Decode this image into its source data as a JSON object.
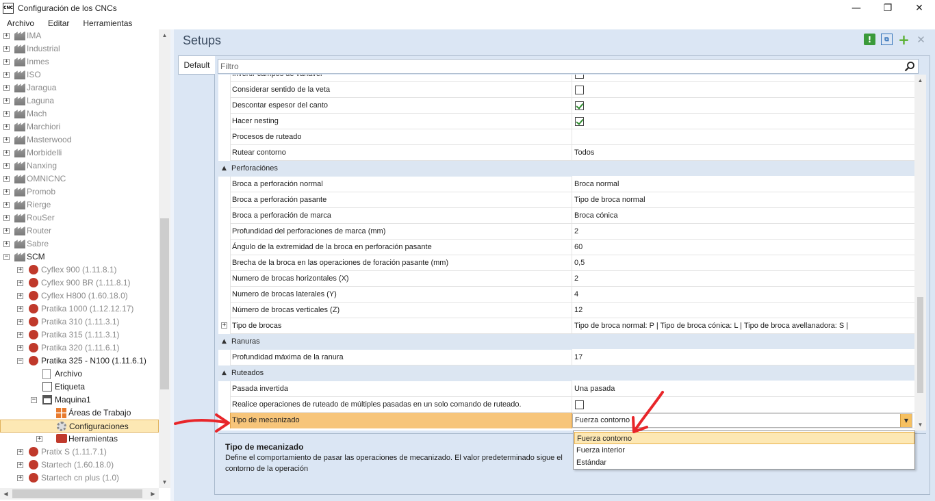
{
  "window": {
    "title": "Configuración de los CNCs",
    "icon_text": "CNC",
    "controls": {
      "minimize": "—",
      "maximize": "❐",
      "close": "✕"
    }
  },
  "menu": [
    "Archivo",
    "Editar",
    "Herramientas"
  ],
  "tree": {
    "manufacturers": [
      "IMA",
      "Industrial",
      "Inmes",
      "ISO",
      "Jaragua",
      "Laguna",
      "Mach",
      "Marchiori",
      "Masterwood",
      "Morbidelli",
      "Nanxing",
      "OMNICNC",
      "Promob",
      "Rierge",
      "RouSer",
      "Router",
      "Sabre"
    ],
    "expanded": "SCM",
    "scm_machines": [
      "Cyflex 900 (1.11.8.1)",
      "Cyflex 900 BR (1.11.8.1)",
      "Cyflex H800 (1.60.18.0)",
      "Pratika 1000 (1.12.12.17)",
      "Pratika 310 (1.11.3.1)",
      "Pratika 315 (1.11.3.1)",
      "Pratika 320 (1.11.6.1)"
    ],
    "open_machine": "Pratika 325 - N100 (1.11.6.1)",
    "open_children": [
      "Archivo",
      "Etiqueta"
    ],
    "maquina": "Maquina1",
    "maquina_children": [
      "Áreas de Trabajo",
      "Configuraciones"
    ],
    "herramientas": "Herramientas",
    "after": [
      "Pratix S (1.11.7.1)",
      "Startech (1.60.18.0)",
      "Startech cn plus (1.0)"
    ]
  },
  "panel": {
    "title": "Setups",
    "tab": "Default",
    "filter_placeholder": "Filtro"
  },
  "grid": {
    "rows": [
      {
        "type": "prop",
        "name": "Invertir campos de variavel",
        "checkbox": false
      },
      {
        "type": "prop",
        "name": "Considerar sentido de la veta",
        "checkbox": false
      },
      {
        "type": "prop",
        "name": "Descontar espesor del canto",
        "checkbox": true
      },
      {
        "type": "prop",
        "name": "Hacer nesting",
        "checkbox": true
      },
      {
        "type": "prop",
        "name": "Procesos de ruteado",
        "value": ""
      },
      {
        "type": "prop",
        "name": "Rutear contorno",
        "value": "Todos"
      },
      {
        "type": "category",
        "name": "Perforaciónes"
      },
      {
        "type": "prop",
        "name": "Broca a perforación normal",
        "value": "Broca normal"
      },
      {
        "type": "prop",
        "name": "Broca a perforación pasante",
        "value": "Tipo de broca normal"
      },
      {
        "type": "prop",
        "name": "Broca a perforación de marca",
        "value": "Broca cónica"
      },
      {
        "type": "prop",
        "name": "Profundidad del perforaciones de marca (mm)",
        "value": "2"
      },
      {
        "type": "prop",
        "name": "Ángulo de la extremidad de la broca en perforación pasante",
        "value": "60"
      },
      {
        "type": "prop",
        "name": "Brecha de la broca en las operaciones de foración pasante (mm)",
        "value": "0,5"
      },
      {
        "type": "prop",
        "name": "Numero de brocas horizontales (X)",
        "value": "2"
      },
      {
        "type": "prop",
        "name": "Numero de brocas laterales (Y)",
        "value": "4"
      },
      {
        "type": "prop",
        "name": "Número de brocas verticales (Z)",
        "value": "12"
      },
      {
        "type": "prop",
        "name": "Tipo de brocas",
        "value": "Tipo de broca normal: P  |  Tipo de broca cónica: L  |  Tipo de broca avellanadora: S  |",
        "expandable": true
      },
      {
        "type": "category",
        "name": "Ranuras"
      },
      {
        "type": "prop",
        "name": "Profundidad máxima de la ranura",
        "value": "17"
      },
      {
        "type": "category",
        "name": "Ruteados"
      },
      {
        "type": "prop",
        "name": "Pasada invertida",
        "value": "Una pasada"
      },
      {
        "type": "prop",
        "name": "Realice operaciones de ruteado de múltiples pasadas en un solo comando de ruteado.",
        "checkbox": false
      },
      {
        "type": "selected",
        "name": "Tipo de mecanizado",
        "value": "Fuerza contorno"
      }
    ]
  },
  "dropdown": {
    "options": [
      "Fuerza contorno",
      "Fuerza interior",
      "Estándar"
    ],
    "selected": "Fuerza contorno"
  },
  "description": {
    "title": "Tipo de mecanizado",
    "text": "Define el comportamiento de pasar las operaciones de mecanizado. El valor predeterminado sigue el contorno de la operación"
  },
  "colors": {
    "accent_selected": "#f7c57a",
    "panel_bg": "#dbe6f4",
    "annotation_arrow": "#e8262a"
  }
}
